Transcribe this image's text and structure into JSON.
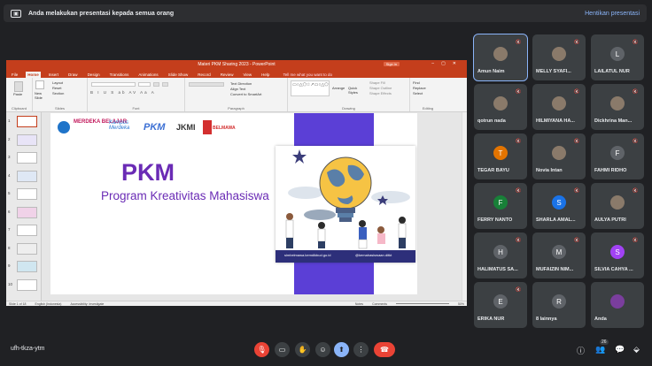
{
  "banner": {
    "message": "Anda melakukan presentasi kepada semua orang",
    "stop": "Hentikan presentasi"
  },
  "ppt": {
    "title": "Materi PKM Sharing 2023 - PowerPoint",
    "signin": "Sign in",
    "tabs": [
      "File",
      "Home",
      "Insert",
      "Draw",
      "Design",
      "Transitions",
      "Animations",
      "Slide Show",
      "Record",
      "Review",
      "View",
      "Help"
    ],
    "tell": "Tell me what you want to do",
    "groups": [
      "Clipboard",
      "Slides",
      "Font",
      "Paragraph",
      "Drawing",
      "Editing"
    ],
    "clipboard": {
      "paste": "Paste"
    },
    "slides": {
      "new": "New Slide",
      "layout": "Layout",
      "reset": "Reset",
      "section": "Section"
    },
    "paragraph": {
      "dir": "Text Direction",
      "align": "Align Text",
      "convert": "Convert to SmartArt"
    },
    "drawing": {
      "arrange": "Arrange",
      "quick": "Quick Styles",
      "fill": "Shape Fill",
      "outline": "Shape Outline",
      "effects": "Shape Effects"
    },
    "editing": {
      "find": "Find",
      "replace": "Replace",
      "select": "Select"
    },
    "status": {
      "slide": "Slide 1 of 18",
      "lang": "English (Indonesia)",
      "access": "Accessibility: Investigate",
      "notes": "Notes",
      "comments": "Comments",
      "zoom": "50%"
    },
    "thumb_numbers": [
      "1",
      "2",
      "3",
      "4",
      "5",
      "6",
      "7",
      "8",
      "9",
      "10"
    ]
  },
  "slide": {
    "logos": [
      "MERDEKA BELAJAR",
      "Kampus Merdeka",
      "PKM",
      "JKMI",
      "BELMAWA"
    ],
    "heading": "PKM",
    "subtitle": "Program Kreativitas Mahasiswa",
    "link1": "simbelmawa.kemdikbud.go.id",
    "link2": "@kemahasiswaan.ditkt"
  },
  "participants": [
    {
      "name": "Amun Naim",
      "initial": "",
      "color": "#3c4043",
      "photo": true
    },
    {
      "name": "MELLY SYAFI...",
      "initial": "",
      "color": "#3c4043",
      "photo": true
    },
    {
      "name": "LAILATUL NUR",
      "initial": "L",
      "color": "#5f6368"
    },
    {
      "name": "qotrun nada",
      "initial": "",
      "color": "#3c4043",
      "photo": true
    },
    {
      "name": "HILMIYANA HA...",
      "initial": "",
      "color": "#3c4043",
      "photo": true
    },
    {
      "name": "Dickhrina Man...",
      "initial": "",
      "color": "#3c4043",
      "photo": true
    },
    {
      "name": "TEGAR BAYU",
      "initial": "T",
      "color": "#e37400"
    },
    {
      "name": "Novia Intan",
      "initial": "",
      "color": "#3c4043",
      "photo": true
    },
    {
      "name": "FAHMI RIDHO",
      "initial": "F",
      "color": "#5f6368"
    },
    {
      "name": "FERRY NANTO",
      "initial": "F",
      "color": "#188038"
    },
    {
      "name": "SHARLA AMAL...",
      "initial": "S",
      "color": "#1a73e8"
    },
    {
      "name": "AULYA PUTRI",
      "initial": "",
      "color": "#3c4043",
      "photo": true
    },
    {
      "name": "HALIMATUS SA...",
      "initial": "H",
      "color": "#5f6368"
    },
    {
      "name": "MUFAIZIN NIM...",
      "initial": "M",
      "color": "#5f6368"
    },
    {
      "name": "SILVIA CAHYA ...",
      "initial": "S",
      "color": "#a142f4"
    },
    {
      "name": "ERIKA NUR",
      "initial": "E",
      "color": "#5f6368"
    },
    {
      "name": "8 lainnya",
      "initial": "R",
      "color": "#5f6368"
    },
    {
      "name": "Anda",
      "initial": "",
      "color": "#3c4043",
      "photo": true
    }
  ],
  "bottom": {
    "meeting_code": "ufh-tkza-ytm",
    "people_count": "26"
  },
  "colors": {
    "ppt_red": "#c43e1c",
    "meet_bg": "#202124",
    "tile_bg": "#3c4043",
    "slide_purple": "#5b3fd6"
  }
}
